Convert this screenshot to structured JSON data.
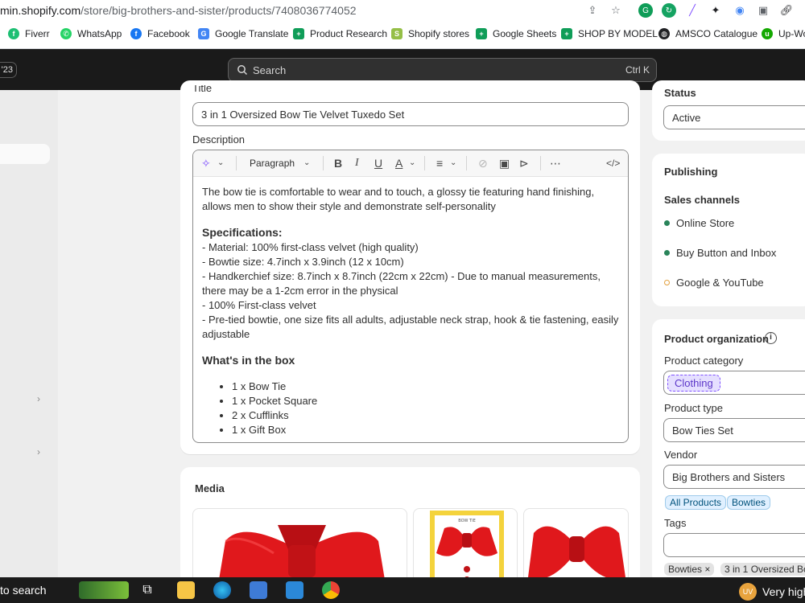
{
  "browser": {
    "url_domain": "min.shopify.com",
    "url_path": "/store/big-brothers-and-sister/products/7408036774052",
    "bookmarks": [
      {
        "label": "Fiverr",
        "icon": "fiverr-icon",
        "color": "#1dbf73"
      },
      {
        "label": "WhatsApp",
        "icon": "whatsapp-icon",
        "color": "#25d366"
      },
      {
        "label": "Facebook",
        "icon": "facebook-icon",
        "color": "#1877f2"
      },
      {
        "label": "Google Translate",
        "icon": "translate-icon",
        "color": "#4285f4"
      },
      {
        "label": "Product Research",
        "icon": "sheets-icon",
        "color": "#0f9d58"
      },
      {
        "label": "Shopify stores",
        "icon": "shopify-icon",
        "color": "#95bf47"
      },
      {
        "label": "Google Sheets",
        "icon": "sheets-icon",
        "color": "#0f9d58"
      },
      {
        "label": "SHOP BY MODEL",
        "icon": "sheets-icon",
        "color": "#0f9d58"
      },
      {
        "label": "AMSCO Catalogue",
        "icon": "globe-icon",
        "color": "#202124"
      },
      {
        "label": "Up-Wo",
        "icon": "upwork-icon",
        "color": "#14a800"
      }
    ]
  },
  "topbar": {
    "badge": "'23",
    "search_label": "Search",
    "search_shortcut": "Ctrl K"
  },
  "product": {
    "title_label": "Title",
    "title_value": "3 in 1 Oversized Bow Tie Velvet Tuxedo Set",
    "description_label": "Description",
    "paragraph_style": "Paragraph",
    "description": {
      "intro": "The bow tie is comfortable to wear and to touch, a glossy tie featuring hand finishing, allows men to show their style and demonstrate self-personality",
      "spec_heading": "Specifications:",
      "specs": [
        "- Material: 100% first-class velvet (high quality)",
        "- Bowtie size: 4.7inch x 3.9inch (12 x 10cm)",
        "- Handkerchief size: 8.7inch x 8.7inch (22cm x 22cm) - Due to manual measurements, there may be a 1-2cm error in the physical",
        "- 100% First-class velvet",
        "- Pre-tied bowtie, one size fits all adults, adjustable neck strap, hook & tie fastening, easily adjustable"
      ],
      "box_heading": "What's in the box",
      "box_items": [
        "1 x Bow Tie",
        "1 x Pocket Square",
        "2 x Cufflinks",
        "1 x Gift Box"
      ]
    },
    "media_label": "Media",
    "media_box_text": "BOW TIE"
  },
  "sidebar_right": {
    "status_label": "Status",
    "status_value": "Active",
    "publishing_label": "Publishing",
    "sales_channels_label": "Sales channels",
    "channels": [
      {
        "name": "Online Store",
        "color": "#29845a",
        "filled": true
      },
      {
        "name": "Buy Button and Inbox",
        "color": "#29845a",
        "filled": true
      },
      {
        "name": "Google & YouTube",
        "color": "#e2a03f",
        "filled": false
      }
    ],
    "org_label": "Product organization",
    "category_label": "Product category",
    "category_value": "Clothing",
    "type_label": "Product type",
    "type_value": "Bow Ties Set",
    "vendor_label": "Vendor",
    "vendor_value": "Big Brothers and Sisters",
    "collections": [
      "All Products",
      "Bowties"
    ],
    "tags_label": "Tags",
    "tags": [
      "Bowties",
      "3 in 1 Oversized Bo"
    ]
  },
  "taskbar": {
    "search_text": "to search",
    "weather": "Very high",
    "user_initials": "UV"
  },
  "colors": {
    "accent": "#8051ff",
    "topbar": "#1a1a1a",
    "active": "#29845a"
  }
}
